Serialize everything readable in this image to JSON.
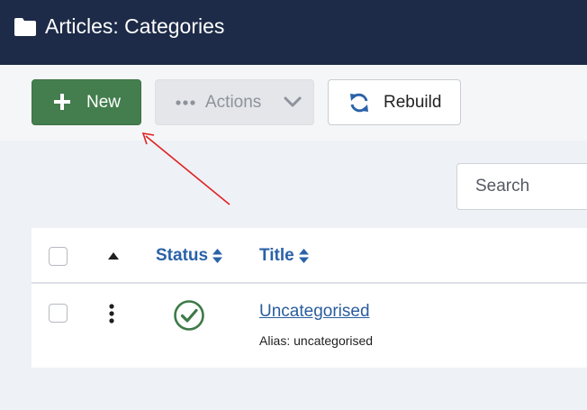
{
  "header": {
    "title": "Articles: Categories",
    "icon": "folder-icon"
  },
  "toolbar": {
    "new_label": "New",
    "actions_label": "Actions",
    "rebuild_label": "Rebuild"
  },
  "search": {
    "placeholder": "Search"
  },
  "table": {
    "columns": {
      "status": "Status",
      "title": "Title"
    },
    "rows": [
      {
        "title": "Uncategorised",
        "alias": "Alias: uncategorised",
        "status": "published"
      }
    ]
  },
  "colors": {
    "header_bg": "#1d2b48",
    "new_button": "#447d4e",
    "link": "#2a62a8",
    "annotation_arrow": "#e02020"
  }
}
